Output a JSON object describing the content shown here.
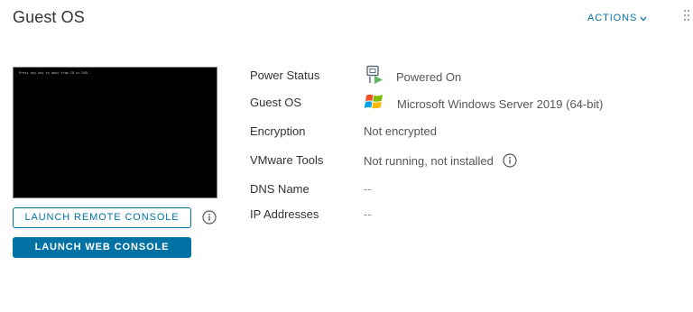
{
  "card": {
    "title": "Guest OS",
    "actions_label": "ACTIONS",
    "actions_chevron": "⌄"
  },
  "console": {
    "screen_text": "Press any key to boot from CD or DVD.."
  },
  "buttons": {
    "launch_remote_console": "LAUNCH REMOTE CONSOLE",
    "launch_web_console": "LAUNCH WEB CONSOLE"
  },
  "properties": {
    "power_status": {
      "label": "Power Status",
      "value": "Powered On",
      "icon": "powered-on-icon"
    },
    "guest_os": {
      "label": "Guest OS",
      "value": "Microsoft Windows Server 2019 (64-bit)",
      "icon": "windows-logo-icon"
    },
    "encryption": {
      "label": "Encryption",
      "value": "Not encrypted"
    },
    "vmware_tools": {
      "label": "VMware Tools",
      "value": "Not running, not installed",
      "icon": "info-icon"
    },
    "dns_name": {
      "label": "DNS Name",
      "value": "--"
    },
    "ip_addresses": {
      "label": "IP Addresses",
      "value": "--"
    }
  },
  "colors": {
    "accent": "#0072a3",
    "power_green": "#5cb85c",
    "text_dark": "#333333",
    "text_muted": "#565656"
  }
}
